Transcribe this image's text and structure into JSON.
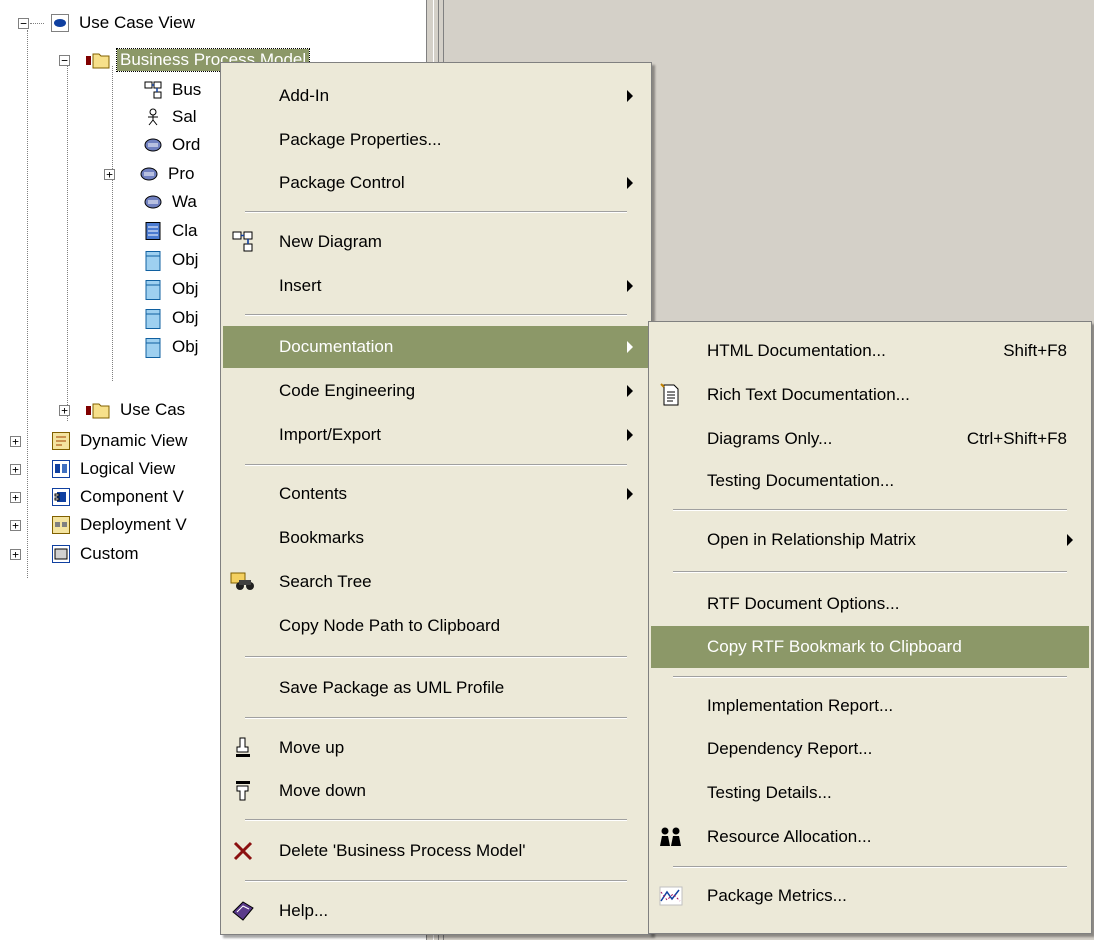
{
  "tree": {
    "root": "Use Case View",
    "selected_folder": "Business Process Model",
    "children": [
      "Bus",
      "Sal",
      "Ord",
      "Pro",
      "Wa",
      "Cla",
      "Obj",
      "Obj",
      "Obj",
      "Obj"
    ],
    "sibling_folder": "Use Cas",
    "top_items": [
      "Dynamic View",
      "Logical View",
      "Component V",
      "Deployment V",
      "Custom"
    ]
  },
  "context_menu": {
    "items": [
      {
        "label": "Add-In",
        "submenu": true
      },
      {
        "label": "Package Properties..."
      },
      {
        "label": "Package Control",
        "submenu": true
      },
      {
        "label": "New Diagram",
        "icon": "new-diagram-icon"
      },
      {
        "label": "Insert",
        "submenu": true
      },
      {
        "label": "Documentation",
        "submenu": true,
        "highlighted": true
      },
      {
        "label": "Code Engineering",
        "submenu": true
      },
      {
        "label": "Import/Export",
        "submenu": true
      },
      {
        "label": "Contents",
        "submenu": true
      },
      {
        "label": "Bookmarks"
      },
      {
        "label": "Search Tree",
        "icon": "binoculars-icon"
      },
      {
        "label": "Copy Node Path to Clipboard"
      },
      {
        "label": "Save Package as UML Profile"
      },
      {
        "label": "Move up",
        "icon": "move-up-icon"
      },
      {
        "label": "Move down",
        "icon": "move-down-icon"
      },
      {
        "label": "Delete 'Business Process Model'",
        "icon": "delete-icon"
      },
      {
        "label": "Help...",
        "icon": "help-book-icon"
      }
    ]
  },
  "documentation_submenu": {
    "items": [
      {
        "label": "HTML Documentation...",
        "shortcut": "Shift+F8"
      },
      {
        "label": "Rich Text Documentation...",
        "icon": "rtf-document-icon"
      },
      {
        "label": "Diagrams Only...",
        "shortcut": "Ctrl+Shift+F8"
      },
      {
        "label": "Testing Documentation..."
      },
      {
        "label": "Open in Relationship Matrix",
        "submenu": true
      },
      {
        "label": "RTF Document Options..."
      },
      {
        "label": "Copy RTF Bookmark to Clipboard",
        "highlighted": true
      },
      {
        "label": "Implementation Report..."
      },
      {
        "label": "Dependency Report..."
      },
      {
        "label": "Testing Details..."
      },
      {
        "label": "Resource Allocation...",
        "icon": "resource-people-icon"
      },
      {
        "label": "Package Metrics...",
        "icon": "metrics-chart-icon"
      }
    ]
  },
  "colors": {
    "highlight": "#8c9868",
    "menu_bg": "#ece9d8",
    "panel_bg": "#d4d0c8"
  }
}
